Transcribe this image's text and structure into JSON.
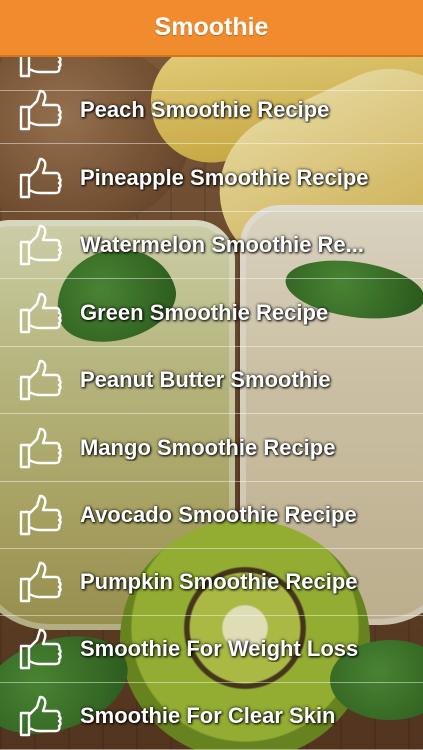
{
  "header": {
    "title": "Smoothie"
  },
  "list": {
    "icon": "thumbs-up-icon",
    "items": [
      {
        "label": ""
      },
      {
        "label": "Peach Smoothie Recipe"
      },
      {
        "label": "Pineapple Smoothie Recipe"
      },
      {
        "label": "Watermelon Smoothie Re..."
      },
      {
        "label": "Green Smoothie Recipe"
      },
      {
        "label": "Peanut Butter Smoothie"
      },
      {
        "label": "Mango Smoothie Recipe"
      },
      {
        "label": "Avocado Smoothie Recipe"
      },
      {
        "label": "Pumpkin Smoothie Recipe"
      },
      {
        "label": "Smoothie For Weight Loss"
      },
      {
        "label": "Smoothie For Clear Skin"
      }
    ]
  },
  "colors": {
    "header": "#f08c2e",
    "text": "#ffffff"
  }
}
